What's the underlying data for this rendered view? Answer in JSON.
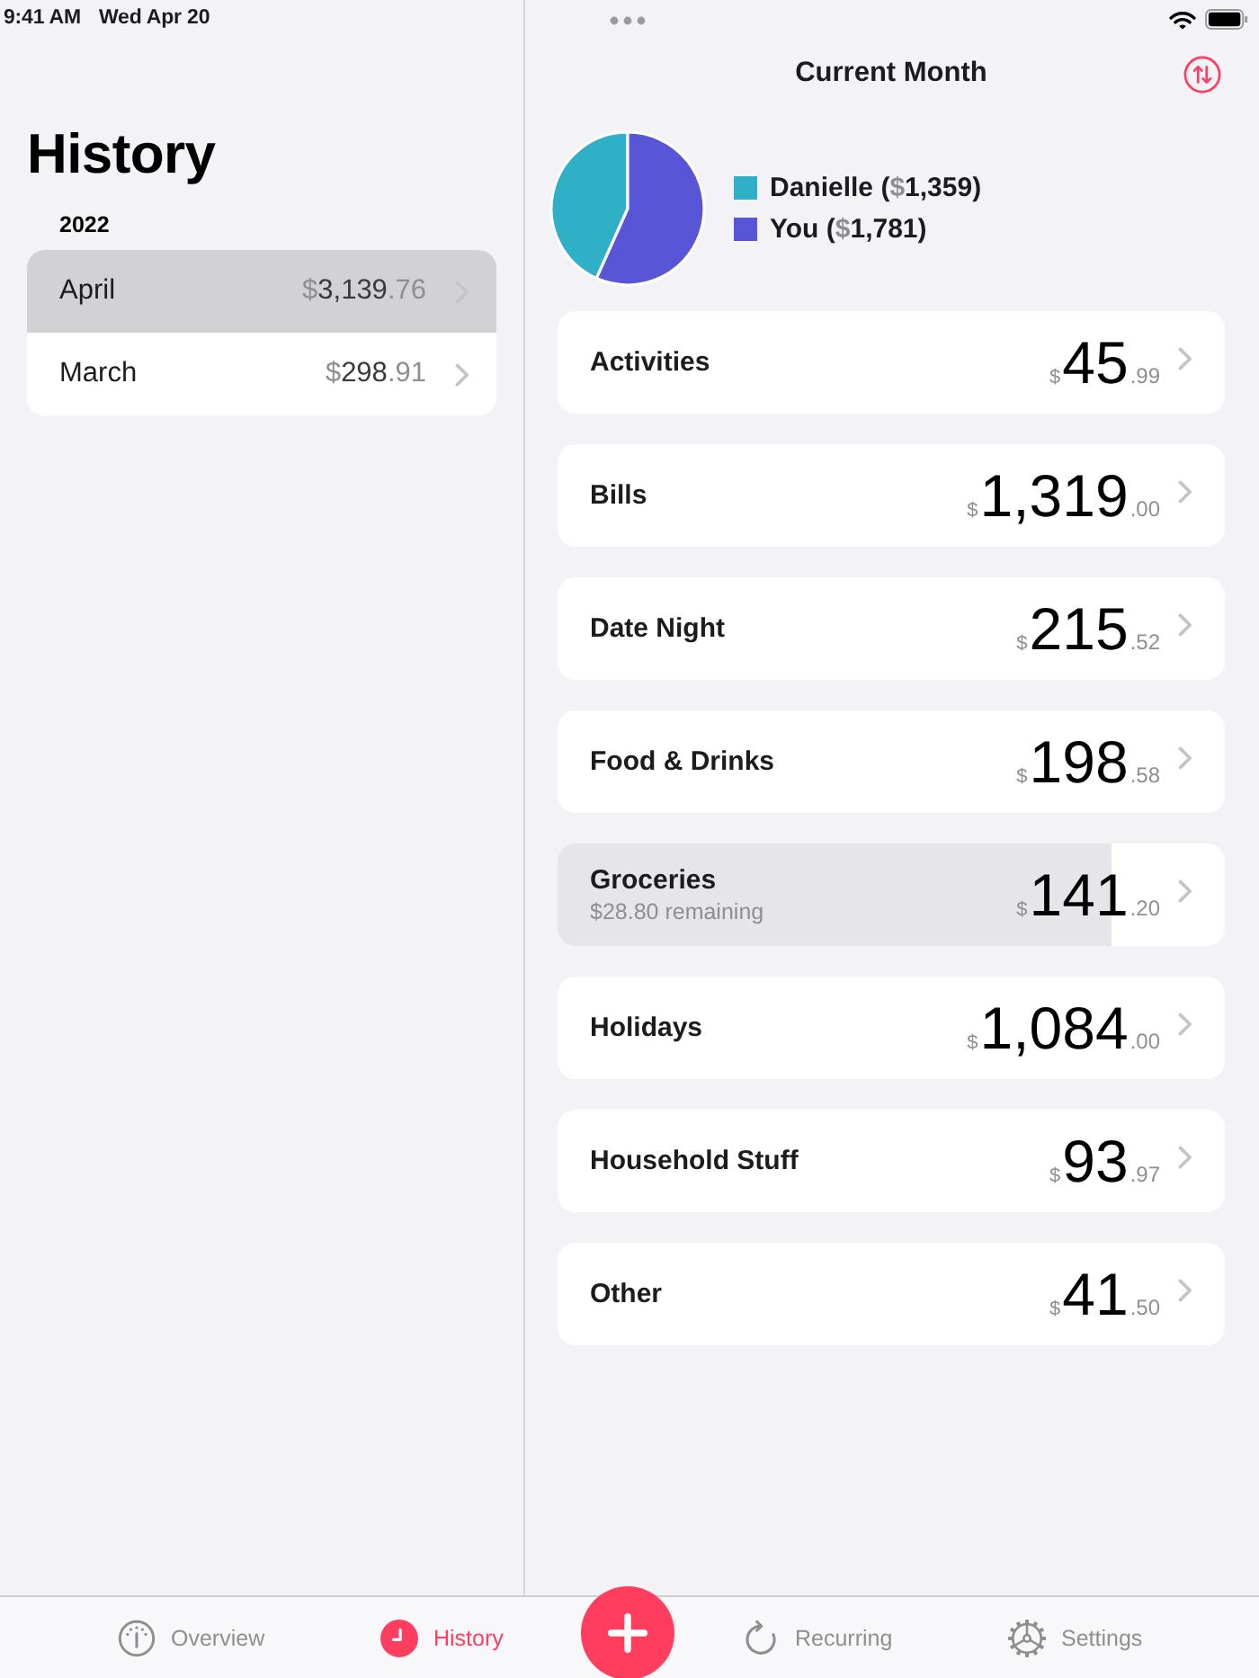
{
  "status_bar": {
    "time": "9:41 AM",
    "date": "Wed Apr 20"
  },
  "sidebar": {
    "title": "History",
    "sections": [
      {
        "year": "2022",
        "months": [
          {
            "name": "April",
            "currency": "$",
            "whole": "3,139",
            "cents": ".76",
            "selected": true
          },
          {
            "name": "March",
            "currency": "$",
            "whole": "298",
            "cents": ".91",
            "selected": false
          }
        ]
      }
    ]
  },
  "main": {
    "title": "Current Month",
    "chart_data": {
      "type": "pie",
      "categories": [
        "Danielle",
        "You"
      ],
      "values": [
        43.3,
        56.7
      ]
    },
    "legend": [
      {
        "open": "(",
        "currency": "$",
        "amount": "1,359",
        "close": ")",
        "color": "#30b0c7"
      },
      {
        "open": "(",
        "currency": "$",
        "amount": "1,781",
        "close": ")",
        "color": "#5856d6"
      }
    ],
    "categories": [
      {
        "name": "Activities",
        "currency": "$",
        "whole": "45",
        "cents": ".99"
      },
      {
        "name": "Bills",
        "currency": "$",
        "whole": "1,319",
        "cents": ".00"
      },
      {
        "name": "Date Night",
        "currency": "$",
        "whole": "215",
        "cents": ".52"
      },
      {
        "name": "Food & Drinks",
        "currency": "$",
        "whole": "198",
        "cents": ".58"
      },
      {
        "name": "Groceries",
        "note": "$28.80 remaining",
        "currency": "$",
        "whole": "141",
        "cents": ".20",
        "level": 0.83
      },
      {
        "name": "Holidays",
        "currency": "$",
        "whole": "1,084",
        "cents": ".00"
      },
      {
        "name": "Household Stuff",
        "currency": "$",
        "whole": "93",
        "cents": ".97"
      },
      {
        "name": "Other",
        "currency": "$",
        "whole": "41",
        "cents": ".50"
      }
    ]
  },
  "tab_bar": {
    "items": [
      {
        "kind": "overview",
        "label": "Overview",
        "selected": false
      },
      {
        "kind": "history",
        "label": "History",
        "selected": true
      },
      {
        "kind": "add"
      },
      {
        "kind": "recurring",
        "label": "Recurring",
        "selected": false
      },
      {
        "kind": "settings",
        "label": "Settings",
        "selected": false
      }
    ]
  }
}
